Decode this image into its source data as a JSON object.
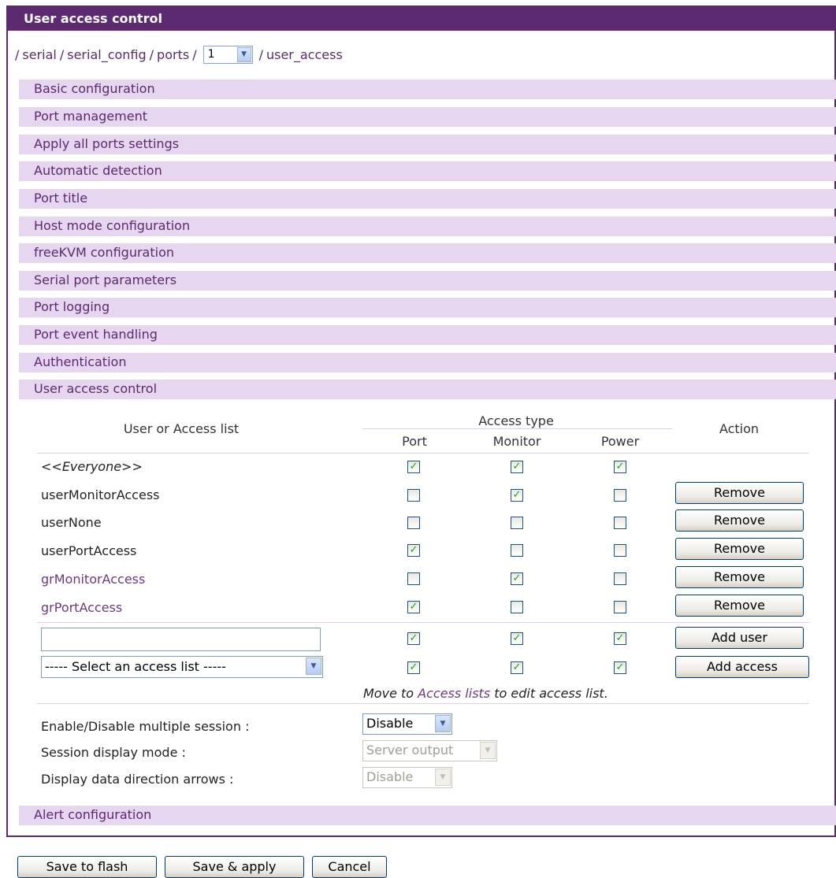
{
  "panel": {
    "title": "User access control"
  },
  "breadcrumb": {
    "items": [
      "serial",
      "serial_config",
      "ports"
    ],
    "separator": "/",
    "port_value": "1",
    "last": "user_access"
  },
  "sections": [
    "Basic configuration",
    "Port management",
    "Apply all ports settings",
    "Automatic detection",
    "Port title",
    "Host mode configuration",
    "freeKVM configuration",
    "Serial port parameters",
    "Port logging",
    "Port event handling",
    "Authentication",
    "User access control"
  ],
  "alert_section": "Alert configuration",
  "table": {
    "col_user": "User or Access list",
    "col_access_type": "Access type",
    "col_port": "Port",
    "col_monitor": "Monitor",
    "col_power": "Power",
    "col_action": "Action",
    "rows": [
      {
        "name": "<<Everyone>>",
        "port": true,
        "monitor": true,
        "power": true,
        "action": ""
      },
      {
        "name": "userMonitorAccess",
        "port": false,
        "monitor": true,
        "power": false,
        "action": "Remove"
      },
      {
        "name": "userNone",
        "port": false,
        "monitor": false,
        "power": false,
        "action": "Remove"
      },
      {
        "name": "userPortAccess",
        "port": true,
        "monitor": false,
        "power": false,
        "action": "Remove"
      },
      {
        "name": "grMonitorAccess",
        "port": false,
        "monitor": true,
        "power": false,
        "action": "Remove"
      },
      {
        "name": "grPortAccess",
        "port": true,
        "monitor": false,
        "power": false,
        "action": "Remove"
      }
    ],
    "add_user_row": {
      "value": "",
      "port": true,
      "monitor": true,
      "power": true,
      "button": "Add user"
    },
    "add_access_row": {
      "select_value": "----- Select an access list -----",
      "port": true,
      "monitor": true,
      "power": true,
      "button": "Add access"
    },
    "hint_prefix": "Move to",
    "hint_link": "Access lists",
    "hint_suffix": "to edit access list."
  },
  "settings": {
    "multi_session_label": "Enable/Disable multiple session :",
    "multi_session_value": "Disable",
    "display_mode_label": "Session display mode :",
    "display_mode_value": "Server output",
    "arrows_label": "Display data direction arrows :",
    "arrows_value": "Disable"
  },
  "buttons": {
    "save_flash": "Save to flash",
    "save_apply": "Save & apply",
    "cancel": "Cancel"
  },
  "colors": {
    "title_bar": "#5c2a70",
    "section_bg": "#e7d6ef",
    "link": "#5a2a6e"
  }
}
